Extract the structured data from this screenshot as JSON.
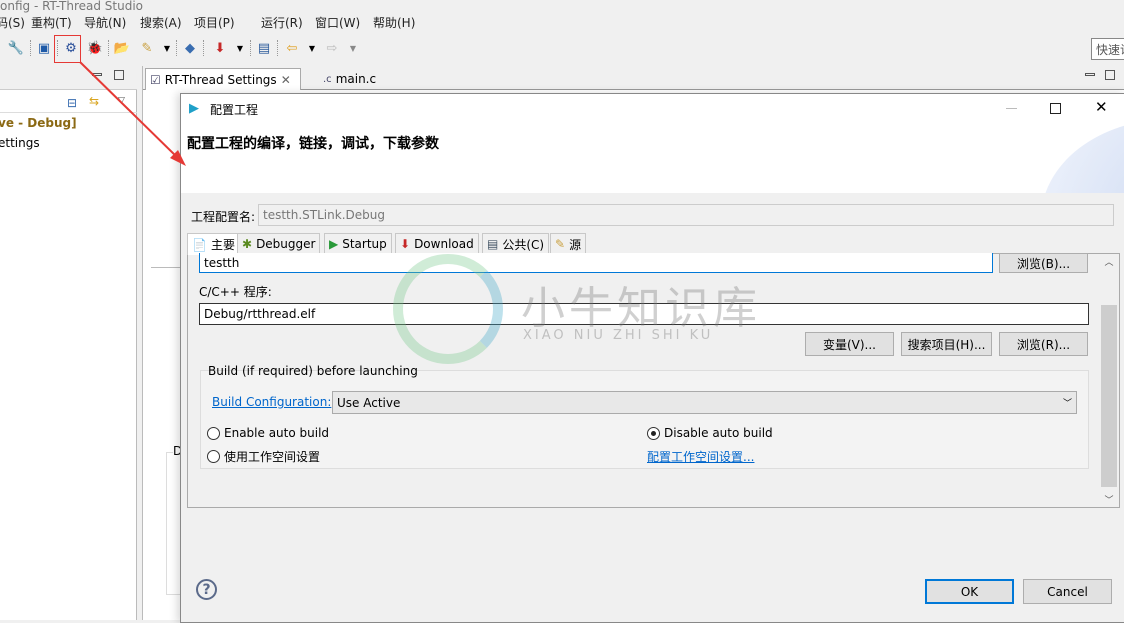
{
  "window": {
    "title": "onfig - RT-Thread Studio"
  },
  "menu": [
    "码(S)",
    "重构(T)",
    "导航(N)",
    "搜索(A)",
    "项目(P)",
    "运行(R)",
    "窗口(W)",
    "帮助(H)"
  ],
  "quick_access": {
    "placeholder": "快速访问"
  },
  "left_panel": {
    "lines": [
      "ve - Debug]",
      "ettings"
    ]
  },
  "editor_tabs": [
    {
      "label": "RT-Thread Settings",
      "active": true
    },
    {
      "label": "main.c"
    }
  ],
  "editor_bg": {
    "group_label": "D"
  },
  "dialog": {
    "title": "配置工程",
    "header": "配置工程的编译，链接，调试，下载参数",
    "config_name_label": "工程配置名:",
    "config_name_value": "testth.STLink.Debug",
    "tabs": [
      {
        "label": "主要",
        "icon": "document-icon"
      },
      {
        "label": "Debugger",
        "icon": "bug-icon"
      },
      {
        "label": "Startup",
        "icon": "play-icon"
      },
      {
        "label": "Download",
        "icon": "download-icon"
      },
      {
        "label": "公共(C)",
        "icon": "table-icon"
      },
      {
        "label": "源",
        "icon": "source-icon"
      }
    ],
    "main": {
      "project_value": "testth",
      "browse_b": "浏览(B)...",
      "program_label": "C/C++ 程序:",
      "program_value": "Debug/rtthread.elf",
      "variables": "变量(V)...",
      "search_project": "搜索项目(H)...",
      "browse_r": "浏览(R)...",
      "build_group": "Build (if required) before launching",
      "build_config_link": "Build Configuration:",
      "build_config_value": "Use Active",
      "enable_auto_build": "Enable auto build",
      "disable_auto_build": "Disable auto build",
      "selected_build_option": "disable",
      "use_workspace": "使用工作空间设置",
      "configure_workspace": "配置工作空间设置..."
    },
    "ok": "OK",
    "cancel": "Cancel"
  },
  "watermark": {
    "cn": "小牛知识库",
    "en": "XIAO NIU ZHI SHI KU"
  },
  "colors": {
    "annotation": "#e53935",
    "link": "#0066cc",
    "accent": "#0078d7"
  }
}
